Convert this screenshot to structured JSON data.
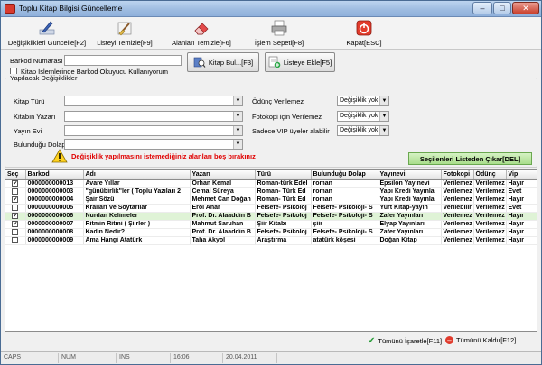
{
  "window": {
    "title": "Toplu Kitap Bilgisi Güncelleme",
    "controls": {
      "minimize": "–",
      "maximize": "□",
      "close": "✕"
    }
  },
  "toolbar": [
    {
      "label": "Değişiklikleri Güncelle[F2]",
      "icon": "pen-icon"
    },
    {
      "label": "Listeyi Temizle[F9]",
      "icon": "broom-icon"
    },
    {
      "label": "Alanları Temizle[F6]",
      "icon": "eraser-icon"
    },
    {
      "label": "İşlem Sepeti[F8]",
      "icon": "printer-icon"
    },
    {
      "label": "Kapat[ESC]",
      "icon": "exit-icon"
    }
  ],
  "barcode": {
    "label": "Barkod Numarası",
    "value": "",
    "reader_checkbox": "Kitap İşlemlerinde Barkod Okuyucu Kullanıyorum",
    "find_button": "Kitap Bul...[F3]",
    "add_button": "Listeye Ekle[F5]"
  },
  "changes": {
    "legend": "Yapılacak Değişiklikler",
    "fields": [
      {
        "label": "Kitap Türü",
        "value": ""
      },
      {
        "label": "Kitabın Yazarı",
        "value": ""
      },
      {
        "label": "Yayın Evi",
        "value": ""
      },
      {
        "label": "Bulunduğu Dolap",
        "value": ""
      }
    ],
    "options": [
      {
        "label": "Ödünç Verilemez",
        "value": "Değişiklik yok"
      },
      {
        "label": "Fotokopi için Verilemez",
        "value": "Değişiklik yok"
      },
      {
        "label": "Sadece VIP üyeler alabilir",
        "value": "Değişiklik yok"
      }
    ],
    "warning": "Değişiklik yapılmasını istemediğiniz alanları boş bırakınız",
    "remove_selected": "Seçilenleri Listeden Çıkar[DEL]"
  },
  "grid": {
    "columns": [
      "Seç",
      "Barkod",
      "Adı",
      "Yazarı",
      "Türü",
      "Bulunduğu Dolap",
      "Yayınevi",
      "Fotokopi",
      "Ödünç",
      "Vip"
    ],
    "rows": [
      {
        "sel": true,
        "barcode": "0000000000013",
        "name": "Avare Yıllar",
        "author": "Orhan Kemal",
        "type": "Roman-türk Edel",
        "shelf": "roman",
        "publisher": "Epsilon Yayınevi",
        "copy": "Verilemez",
        "loan": "Verilemez",
        "vip": "Hayır"
      },
      {
        "sel": false,
        "barcode": "0000000000003",
        "name": "\"günübirlik\"ler ( Toplu Yazıları 2",
        "author": "Cemal Süreya",
        "type": "Roman- Türk Ed",
        "shelf": "roman",
        "publisher": "Yapı Kredi Yayınla",
        "copy": "Verilemez",
        "loan": "Verilemez",
        "vip": "Evet"
      },
      {
        "sel": true,
        "barcode": "0000000000004",
        "name": "Şair Sözü",
        "author": "Mehmet Can Doğan",
        "type": "Roman- Türk Ed",
        "shelf": "roman",
        "publisher": "Yapı Kredi Yayınla",
        "copy": "Verilemez",
        "loan": "Verilemez",
        "vip": "Hayır"
      },
      {
        "sel": false,
        "barcode": "0000000000005",
        "name": "Kralları Ve Soytarılar",
        "author": "Erol Anar",
        "type": "Felsefe- Psikoloj",
        "shelf": "Felsefe- Psikoloji- S",
        "publisher": "Yurt Kitap-yayın",
        "copy": "Verilebilir",
        "loan": "Verilemez",
        "vip": "Evet"
      },
      {
        "sel": true,
        "barcode": "0000000000006",
        "name": "Nurdan Kelimeler",
        "author": "Prof. Dr. Alaaddin B",
        "type": "Felsefe- Psikoloj",
        "shelf": "Felsefe- Psikoloji- S",
        "publisher": "Zafer Yayınları",
        "copy": "Verilemez",
        "loan": "Verilemez",
        "vip": "Hayır",
        "highlight": true
      },
      {
        "sel": true,
        "barcode": "0000000000007",
        "name": "Ritmin Ritmi ( Şiirler )",
        "author": "Mahmut Saruhan",
        "type": "Şiir Kitabı",
        "shelf": "şiir",
        "publisher": "Elyap Yayınları",
        "copy": "Verilemez",
        "loan": "Verilemez",
        "vip": "Hayır"
      },
      {
        "sel": false,
        "barcode": "0000000000008",
        "name": "Kadın Nedir?",
        "author": "Prof. Dr. Alaaddin B",
        "type": "Felsefe- Psikoloj",
        "shelf": "Felsefe- Psikoloji- S",
        "publisher": "Zafer Yayınları",
        "copy": "Verilemez",
        "loan": "Verilemez",
        "vip": "Hayır"
      },
      {
        "sel": false,
        "barcode": "0000000000009",
        "name": "Ama Hangi Atatürk",
        "author": "Taha Akyol",
        "type": "Araştırma",
        "shelf": "atatürk köşesi",
        "publisher": "Doğan Kitap",
        "copy": "Verilemez",
        "loan": "Verilemez",
        "vip": "Hayır"
      }
    ]
  },
  "footer": {
    "mark_all": "Tümünü İşaretle[F11]",
    "unmark_all": "Tümünü Kaldır[F12]"
  },
  "status": {
    "caps": "CAPS",
    "num": "NUM",
    "ins": "INS",
    "time": "16:06",
    "date": "20.04.2011"
  },
  "colors": {
    "title_bar": "#9dbbe0",
    "highlight_row": "#dff3d6",
    "warning_text": "#e00000",
    "green_button": "#a8dd8b"
  }
}
